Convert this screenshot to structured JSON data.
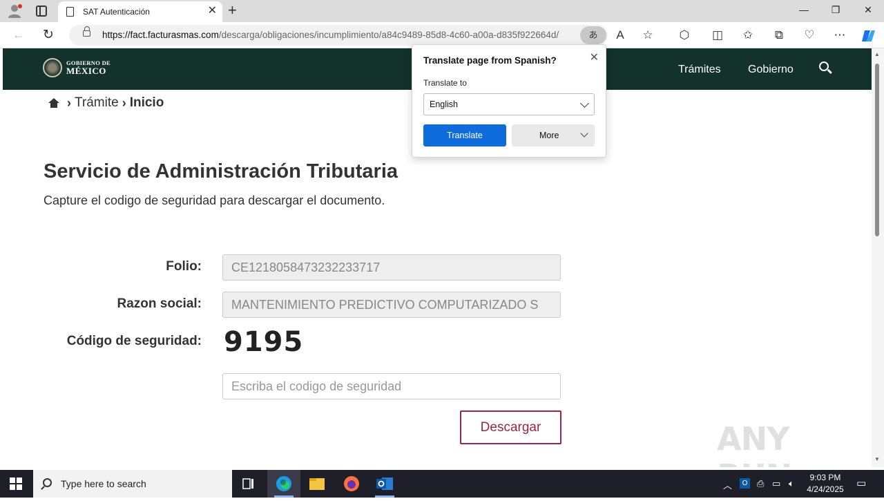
{
  "browser": {
    "tab_title": "SAT Autenticación",
    "url_domain": "https://fact.facturasmas.com",
    "url_path": "/descarga/obligaciones/incumplimiento/a84c9489-85d8-4c60-a00a-d835f922664d/",
    "translate_icon_glyph": "あ"
  },
  "translate_popup": {
    "title": "Translate page from Spanish?",
    "label": "Translate to",
    "selected_language": "English",
    "translate_button": "Translate",
    "more_button": "More"
  },
  "gov_header": {
    "logo_top": "GOBIERNO DE",
    "logo_bottom": "MÉXICO",
    "nav_items": [
      "Trámites",
      "Gobierno"
    ]
  },
  "breadcrumb": {
    "item1": "Trámite",
    "item2": "Inicio"
  },
  "page": {
    "heading": "Servicio de Administración Tributaria",
    "subheading": "Capture el codigo de seguridad para descargar el documento."
  },
  "form": {
    "folio_label": "Folio:",
    "folio_value": "CE1218058473232233717",
    "razon_label": "Razon social:",
    "razon_value": "MANTENIMIENTO PREDICTIVO COMPUTARIZADO S",
    "codigo_label": "Código de seguridad:",
    "captcha_value": "9195",
    "codigo_placeholder": "Escriba el codigo de seguridad",
    "submit_label": "Descargar"
  },
  "watermark": "ANY RUN",
  "taskbar": {
    "search_placeholder": "Type here to search",
    "time": "9:03 PM",
    "date": "4/24/2025"
  },
  "colors": {
    "gov_green": "#13322b",
    "button_border": "#9d2449",
    "translate_blue": "#0f6cdc"
  }
}
